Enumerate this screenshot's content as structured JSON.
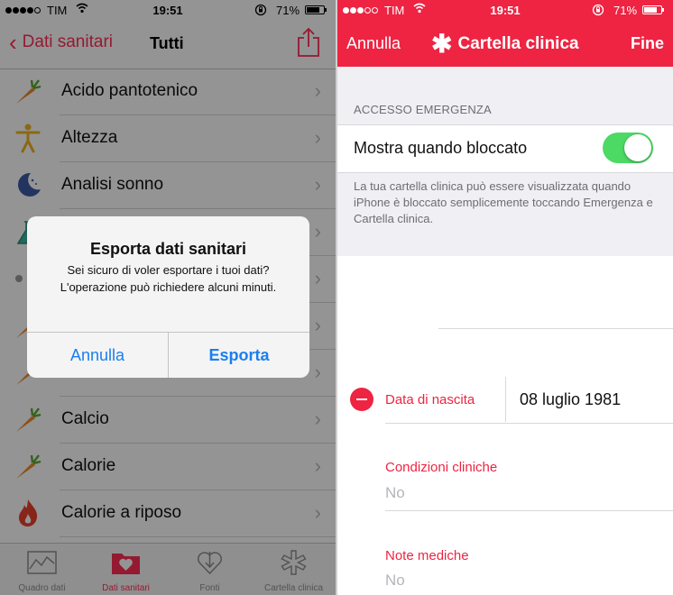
{
  "left": {
    "status": {
      "carrier": "TIM",
      "time": "19:51",
      "battery": "71%"
    },
    "nav": {
      "back_label": "Dati sanitari",
      "title": "Tutti"
    },
    "items": [
      {
        "label": "Acido pantotenico",
        "icon": "carrot-icon"
      },
      {
        "label": "Altezza",
        "icon": "person-icon"
      },
      {
        "label": "Analisi sonno",
        "icon": "moon-icon"
      },
      {
        "label": "",
        "icon": "flask-icon"
      },
      {
        "label": "",
        "icon": "dot-icon"
      },
      {
        "label": "",
        "icon": "carrot-icon"
      },
      {
        "label": "",
        "icon": "carrot-icon"
      },
      {
        "label": "Calcio",
        "icon": "carrot-icon"
      },
      {
        "label": "Calorie",
        "icon": "carrot-icon"
      },
      {
        "label": "Calorie a riposo",
        "icon": "flame-icon"
      }
    ],
    "alert": {
      "title": "Esporta dati sanitari",
      "message": "Sei sicuro di voler esportare i tuoi dati? L'operazione può richiedere alcuni minuti.",
      "cancel": "Annulla",
      "confirm": "Esporta"
    },
    "tabs": [
      {
        "label": "Quadro dati",
        "icon": "chart-icon"
      },
      {
        "label": "Dati sanitari",
        "icon": "folder-heart-icon"
      },
      {
        "label": "Fonti",
        "icon": "download-heart-icon"
      },
      {
        "label": "Cartella clinica",
        "icon": "asterisk-icon"
      }
    ],
    "active_tab": "Dati sanitari"
  },
  "right": {
    "status": {
      "carrier": "TIM",
      "time": "19:51",
      "battery": "71%"
    },
    "nav": {
      "cancel": "Annulla",
      "title": "Cartella clinica",
      "done": "Fine"
    },
    "section_header": "ACCESSO EMERGENZA",
    "toggle": {
      "label": "Mostra quando bloccato",
      "on": true
    },
    "footnote": "La tua cartella clinica può essere visualizzata quando iPhone è bloccato semplicemente toccando Emergenza e Cartella clinica.",
    "birth": {
      "label": "Data di nascita",
      "value": "08 luglio 1981"
    },
    "conditions": {
      "label": "Condizioni cliniche",
      "value": "No"
    },
    "notes": {
      "label": "Note mediche",
      "value": "No"
    }
  },
  "colors": {
    "accent": "#ff2d55",
    "header_red": "#ee2442",
    "ios_blue": "#1a7ff0",
    "switch_green": "#4cd964"
  }
}
